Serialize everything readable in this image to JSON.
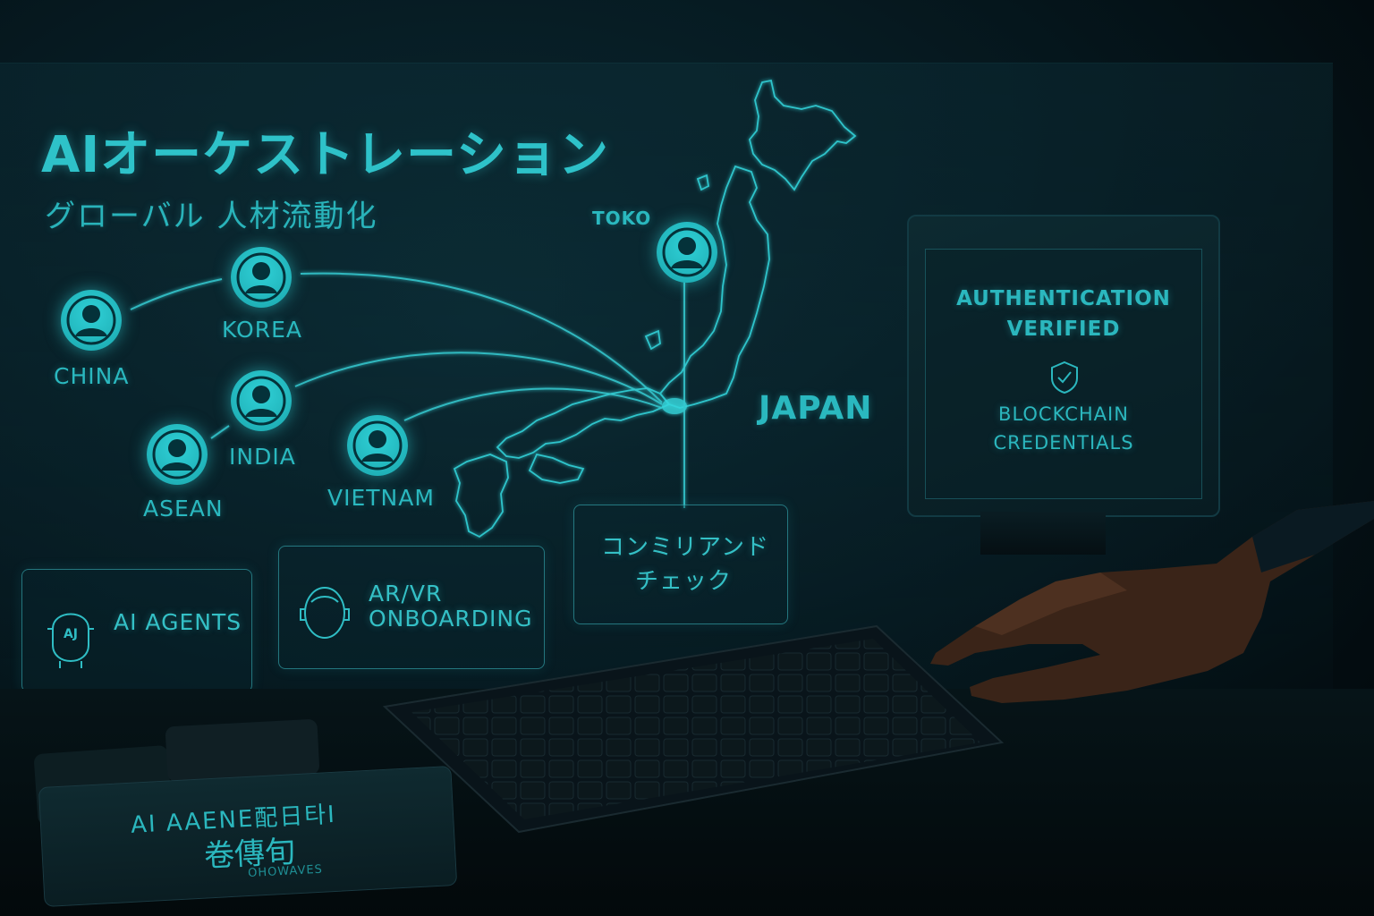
{
  "heading": {
    "title": "AIオーケストレーション",
    "subtitle": "グローバル 人材流動化"
  },
  "map": {
    "hub_label": "TOKO",
    "country_label": "JAPAN",
    "origins": [
      {
        "label": "CHINA"
      },
      {
        "label": "KOREA"
      },
      {
        "label": "INDIA"
      },
      {
        "label": "ASEAN"
      },
      {
        "label": "VIETNAM"
      }
    ]
  },
  "panels": {
    "ai_agents": {
      "label": "AI AGENTS",
      "icon": "ai-head-icon"
    },
    "ar_vr": {
      "line1": "AR/VR",
      "line2": "ONBOARDING",
      "icon": "vr-head-icon"
    },
    "compliance": {
      "line1": "コンミリアンド",
      "line2": "チェック"
    }
  },
  "monitor": {
    "auth_line1": "AUTHENTICATION",
    "auth_line2": "VERIFIED",
    "icon": "shield-check-icon",
    "chain_line1": "BLOCKCHAIN",
    "chain_line2": "CREDENTIALS"
  },
  "desk_card": {
    "line1": "AI AAENE配日타I",
    "line2": "卷傳旬",
    "line3": "OHOWAVES"
  },
  "colors": {
    "accent": "#2ec2c9",
    "background": "#061a21"
  }
}
